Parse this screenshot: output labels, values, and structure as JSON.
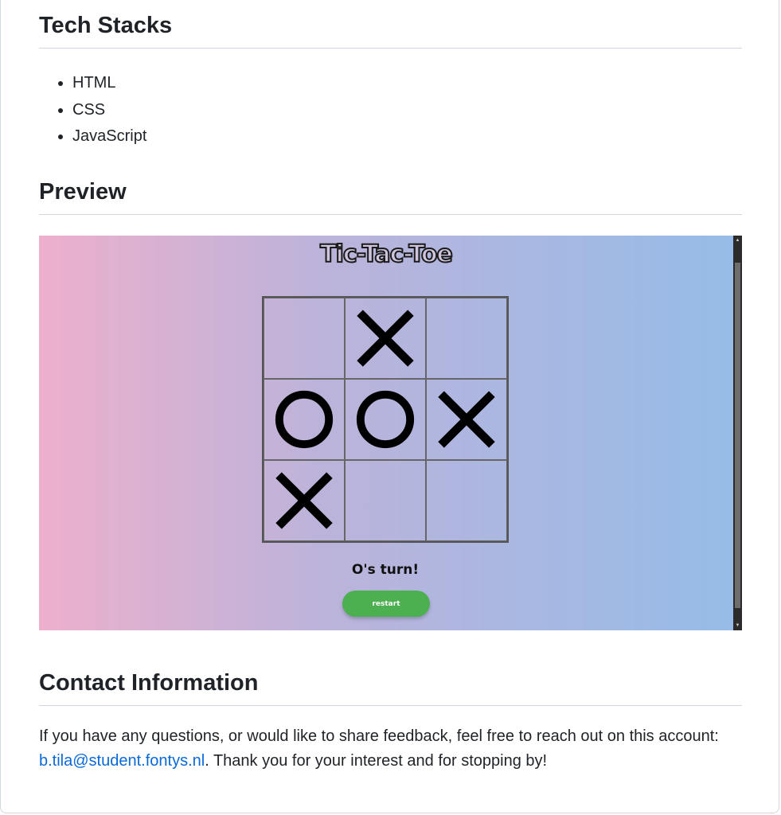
{
  "sections": {
    "tech_title": "Tech Stacks",
    "tech_items": [
      "HTML",
      "CSS",
      "JavaScript"
    ],
    "preview_title": "Preview",
    "contact_title": "Contact Information"
  },
  "game": {
    "title": "Tic-Tac-Toe",
    "board": [
      "",
      "X",
      "",
      "O",
      "O",
      "X",
      "X",
      "",
      ""
    ],
    "turn_text": "O's turn!",
    "restart_label": "restart"
  },
  "contact": {
    "text_before": "If you have any questions, or would like to share feedback, feel free to reach out on this account: ",
    "email": "b.tila@student.fontys.nl",
    "text_after": ". Thank you for your interest and for stopping by!"
  },
  "colors": {
    "link": "#0969da",
    "restart_button": "#4caf50"
  }
}
